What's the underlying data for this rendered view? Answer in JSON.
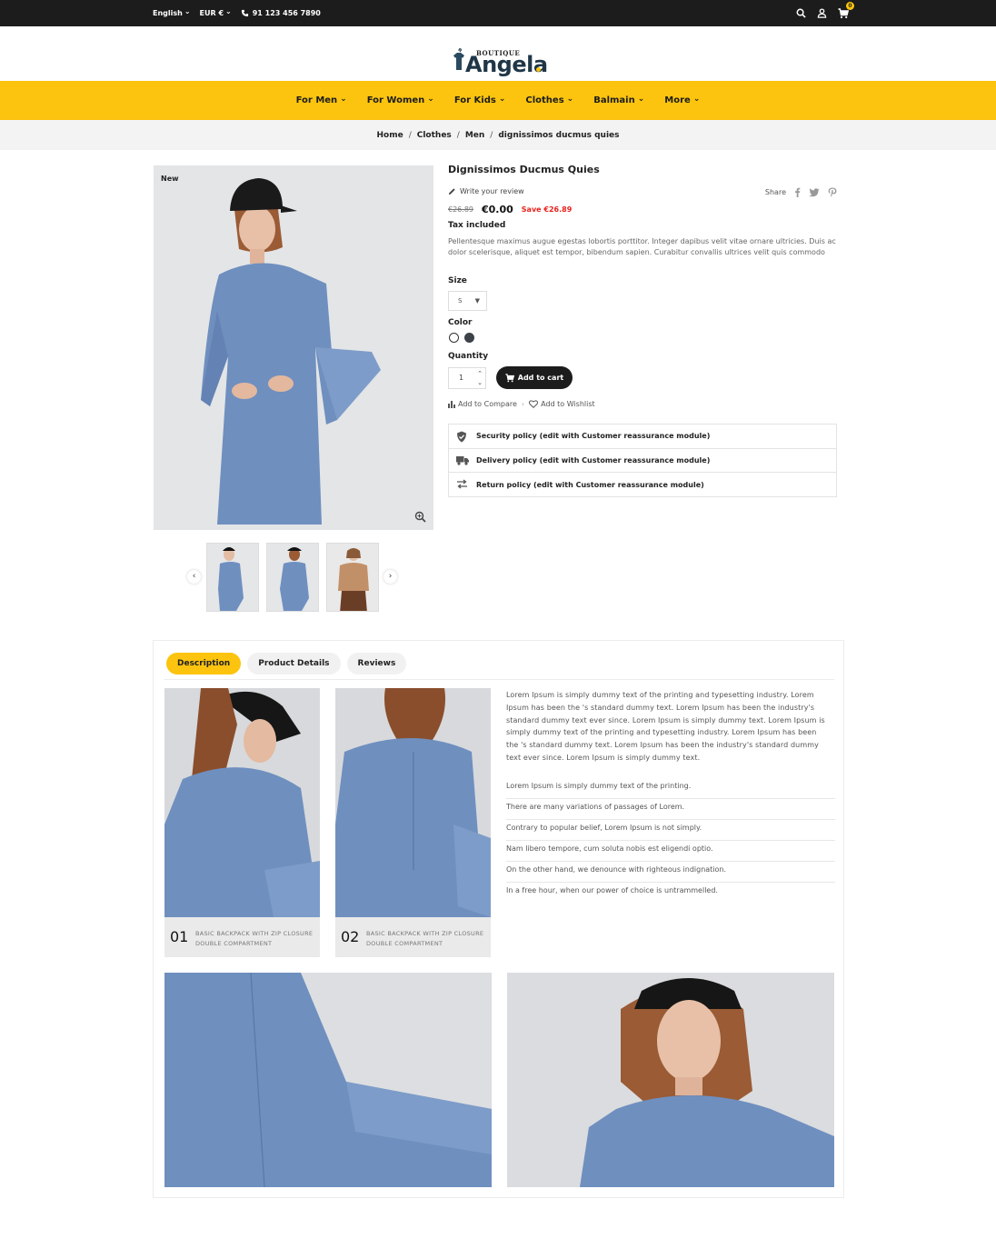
{
  "topbar": {
    "language": "English",
    "currency": "EUR €",
    "phone": "91 123 456 7890",
    "cart_count": "0"
  },
  "logo": {
    "small": "BOUTIQUE",
    "main": "Angela"
  },
  "nav": [
    "For Men",
    "For Women",
    "For Kids",
    "Clothes",
    "Balmain",
    "More"
  ],
  "breadcrumb": [
    "Home",
    "Clothes",
    "Men",
    "dignissimos ducmus quies"
  ],
  "product": {
    "badge": "New",
    "name": "Dignissimos Ducmus Quies",
    "write_review": "Write your review",
    "share_label": "Share",
    "old_price": "€26.89",
    "price": "€0.00",
    "save": "Save €26.89",
    "tax": "Tax included",
    "description": "Pellentesque maximus augue egestas lobortis porttitor. Integer dapibus velit vitae ornare ultricies. Duis ac dolor scelerisque, aliquet est tempor, bibendum sapien. Curabitur convallis ultrices velit quis commodo",
    "size_label": "Size",
    "size_value": "S",
    "color_label": "Color",
    "colors": [
      "#ffffff",
      "#3d4148"
    ],
    "quantity_label": "Quantity",
    "quantity": "1",
    "add_to_cart": "Add to cart",
    "compare": "Add to Compare",
    "wishlist": "Add to Wishlist",
    "reassurance": [
      "Security policy (edit with Customer reassurance module)",
      "Delivery policy (edit with Customer reassurance module)",
      "Return policy (edit with Customer reassurance module)"
    ]
  },
  "tabs": [
    "Description",
    "Product Details",
    "Reviews"
  ],
  "cards": [
    {
      "num": "01",
      "caption": "BASIC BACKPACK WITH ZIP CLOSURE DOUBLE COMPARTMENT"
    },
    {
      "num": "02",
      "caption": "BASIC BACKPACK WITH ZIP CLOSURE DOUBLE COMPARTMENT"
    }
  ],
  "paragraph": "Lorem Ipsum is simply dummy text of the printing and typesetting industry. Lorem Ipsum has been the 's standard dummy text. Lorem Ipsum has been the industry's standard dummy text ever since. Lorem Ipsum is simply dummy text. Lorem Ipsum is simply dummy text of the printing and typesetting industry. Lorem Ipsum has been the 's standard dummy text. Lorem Ipsum has been the industry's standard dummy text ever since. Lorem Ipsum is simply dummy text.",
  "bullets": [
    "Lorem Ipsum is simply dummy text of the printing.",
    "There are many variations of passages of Lorem.",
    "Contrary to popular belief, Lorem Ipsum is not simply.",
    "Nam libero tempore, cum soluta nobis est eligendi optio.",
    "On the other hand, we denounce with righteous indignation.",
    "In a free hour, when our power of choice is untrammelled."
  ],
  "colors": {
    "accent": "#fcc40f",
    "dark": "#1c1c1c",
    "sale": "#e8221d",
    "denim": "#6f8fbf"
  }
}
